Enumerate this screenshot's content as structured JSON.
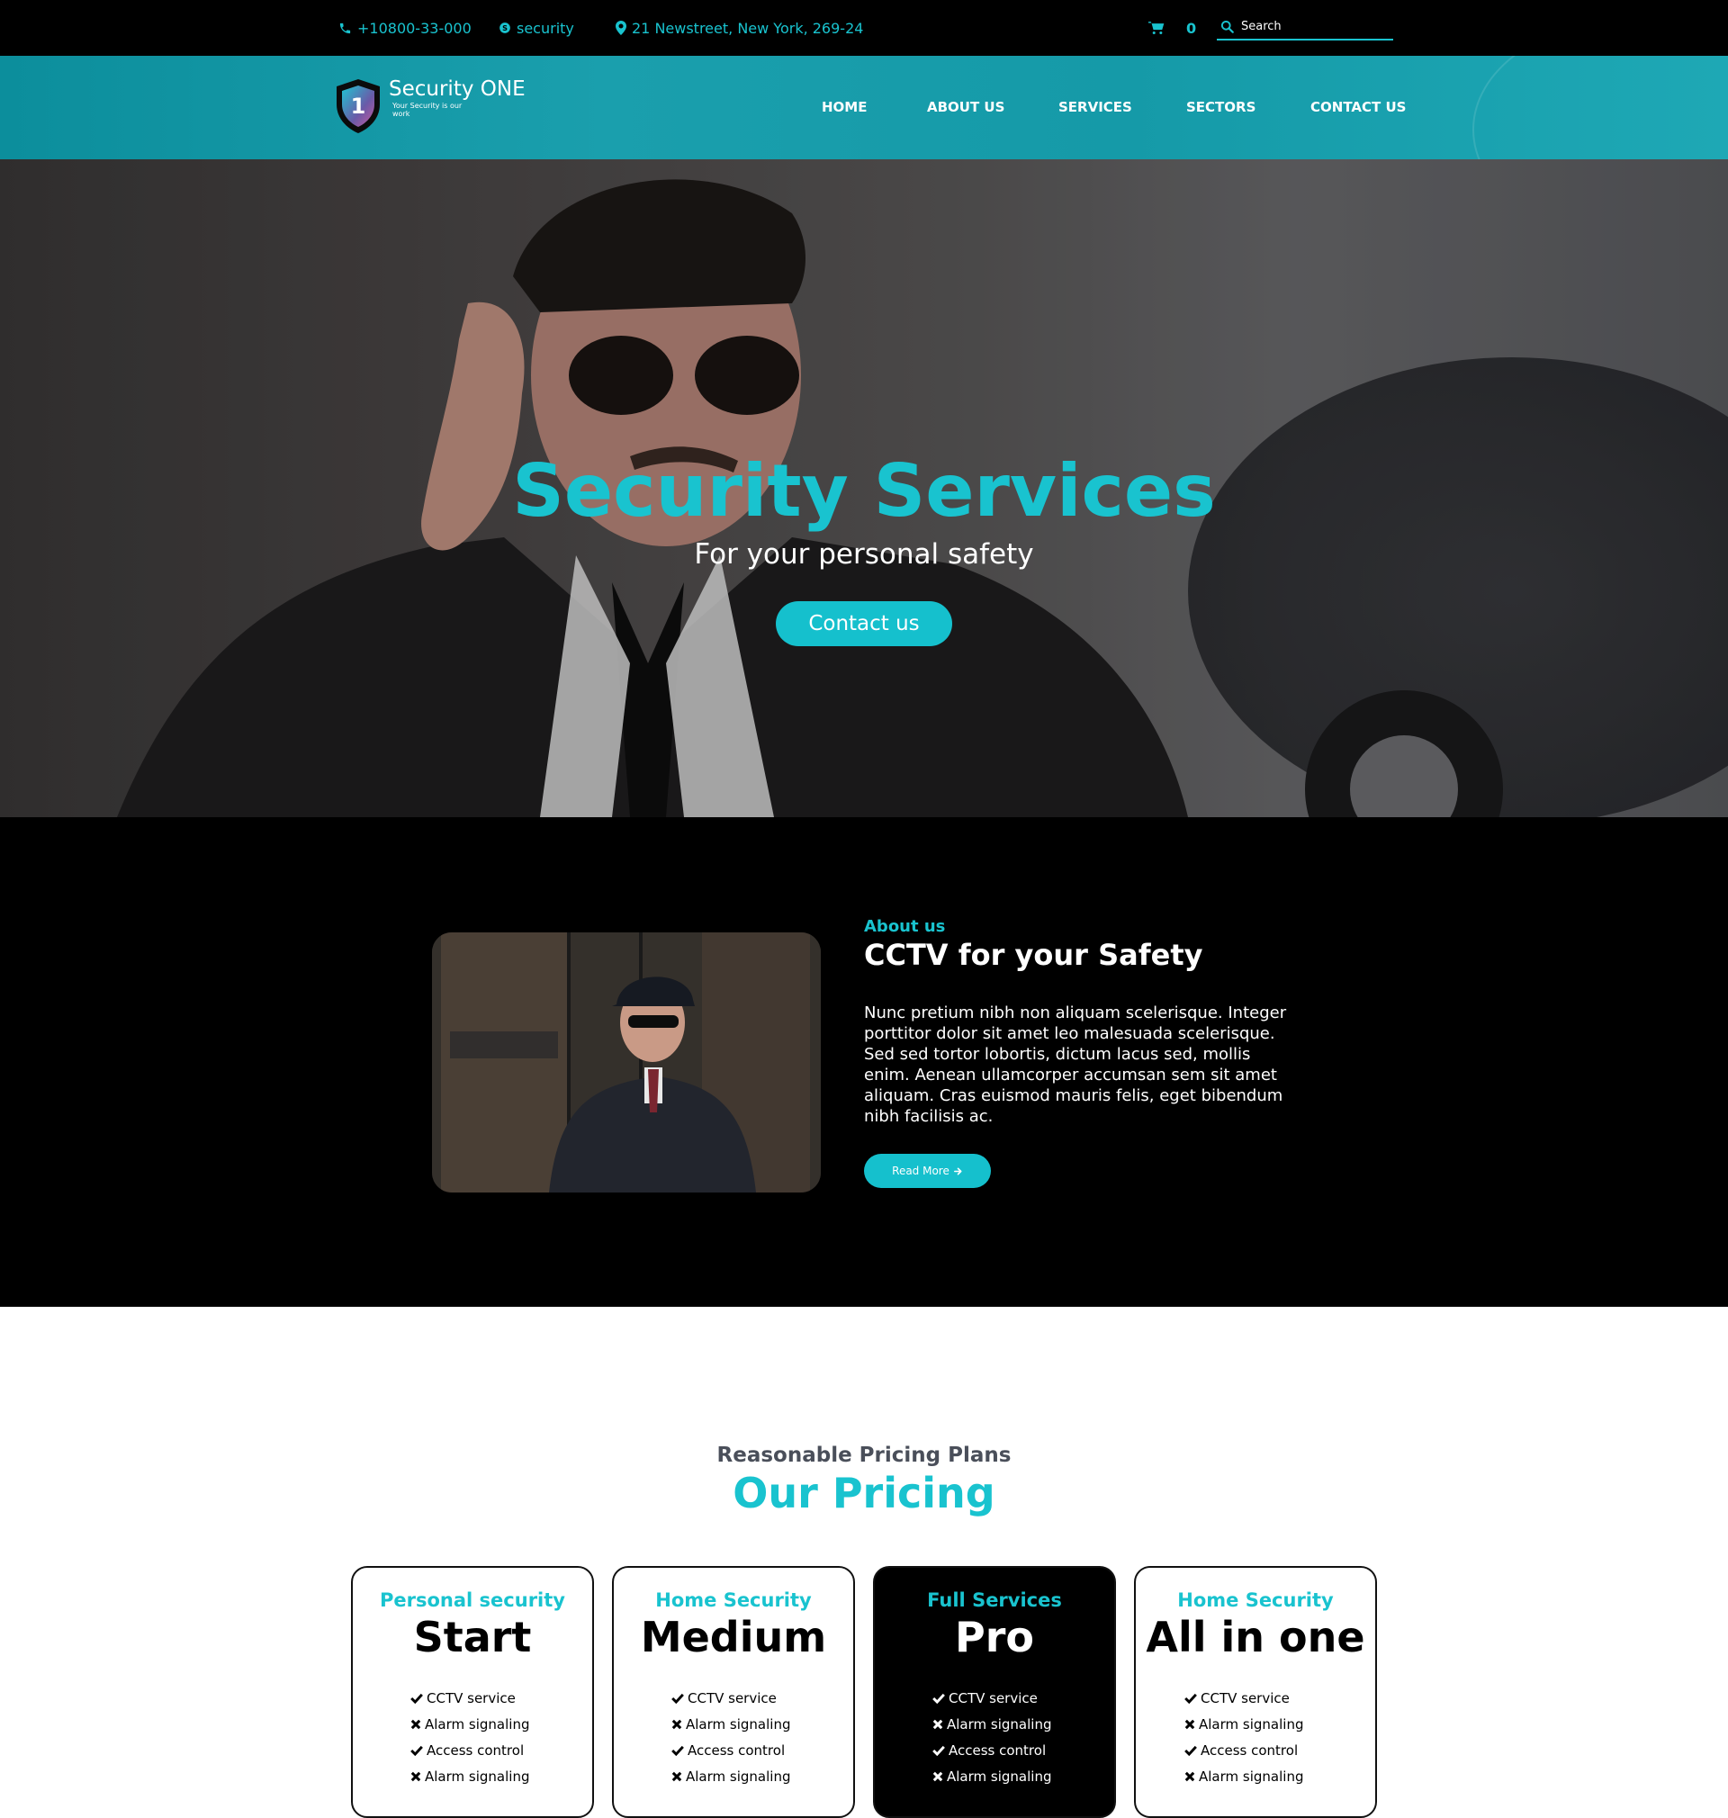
{
  "topbar": {
    "phone": "+10800-33-000",
    "skype": "security",
    "address": "21 Newstreet, New York, 269-24",
    "cart_count": "0",
    "search_placeholder": "Search",
    "icons": {
      "phone": "phone-icon",
      "skype": "skype-icon",
      "address": "map-pin-icon",
      "cart": "cart-icon",
      "search": "search-icon"
    }
  },
  "header": {
    "logo_name": "Security ONE",
    "logo_tagline": "Your Security is our work",
    "logo_badge": "1",
    "nav": [
      "HOME",
      "ABOUT US",
      "SERVICES",
      "SECTORS",
      "CONTACT US"
    ]
  },
  "hero": {
    "title": "Security Services",
    "subtitle": "For your personal safety",
    "button": "Contact us"
  },
  "about": {
    "eyebrow": "About us",
    "title": "CCTV for your Safety",
    "text": "Nunc pretium nibh non aliquam scelerisque. Integer porttitor dolor sit amet leo malesuada scelerisque. Sed sed tortor lobortis, dictum lacus sed, mollis enim. Aenean ullamcorper accumsan sem sit amet aliquam. Cras euismod mauris felis, eget bibendum nibh facilisis ac.",
    "button": "Read More"
  },
  "pricing": {
    "eyebrow": "Reasonable Pricing Plans",
    "title": "Our Pricing",
    "plans": [
      {
        "category": "Personal security",
        "name": "Start",
        "dark": false,
        "features": [
          {
            "label": "CCTV service",
            "included": true
          },
          {
            "label": "Alarm signaling",
            "included": false
          },
          {
            "label": "Access control",
            "included": true
          },
          {
            "label": "Alarm signaling",
            "included": false
          }
        ]
      },
      {
        "category": "Home Security",
        "name": "Medium",
        "dark": false,
        "features": [
          {
            "label": "CCTV service",
            "included": true
          },
          {
            "label": "Alarm signaling",
            "included": false
          },
          {
            "label": "Access control",
            "included": true
          },
          {
            "label": "Alarm signaling",
            "included": false
          }
        ]
      },
      {
        "category": "Full Services",
        "name": "Pro",
        "dark": true,
        "features": [
          {
            "label": "CCTV service",
            "included": true
          },
          {
            "label": "Alarm signaling",
            "included": false
          },
          {
            "label": "Access control",
            "included": true
          },
          {
            "label": "Alarm signaling",
            "included": false
          }
        ]
      },
      {
        "category": "Home Security",
        "name": "All in one",
        "dark": false,
        "features": [
          {
            "label": "CCTV service",
            "included": true
          },
          {
            "label": "Alarm signaling",
            "included": false
          },
          {
            "label": "Access control",
            "included": true
          },
          {
            "label": "Alarm signaling",
            "included": false
          }
        ]
      }
    ]
  },
  "colors": {
    "accent": "#19c3cf",
    "topbar_bg": "#000000",
    "header_bg": "#1a9fad"
  }
}
